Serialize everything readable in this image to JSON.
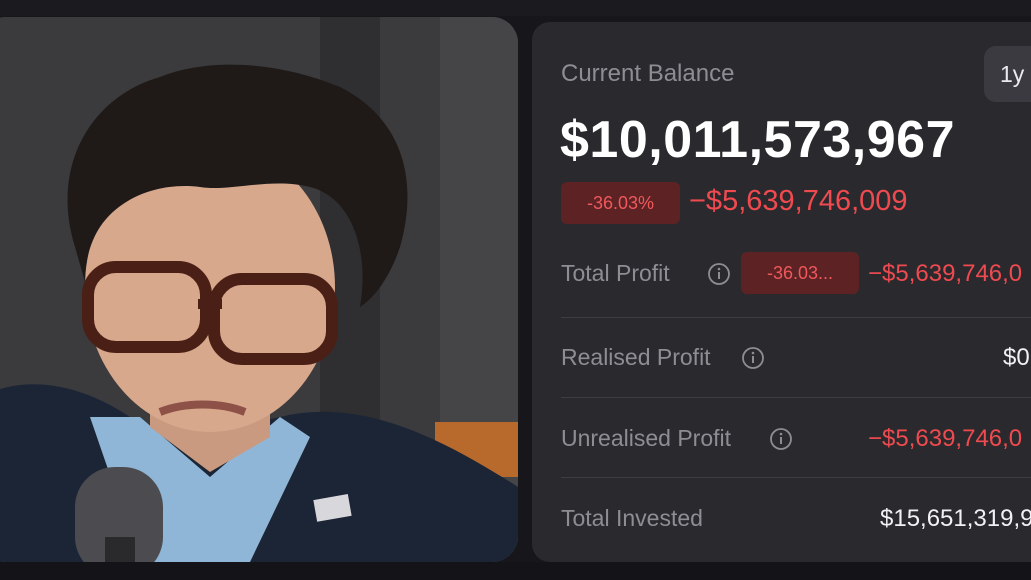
{
  "balance_card": {
    "current_balance_label": "Current Balance",
    "period_button": "1y",
    "balance": "$10,011,573,967",
    "change_percent": "-36.03%",
    "change_amount": "−$5,639,746,009"
  },
  "rows": {
    "total_profit": {
      "label": "Total Profit",
      "badge": "-36.03...",
      "value": "−$5,639,746,0"
    },
    "realised_profit": {
      "label": "Realised Profit",
      "value": "$0"
    },
    "unrealised_profit": {
      "label": "Unrealised Profit",
      "value": "−$5,639,746,0"
    },
    "total_invested": {
      "label": "Total Invested",
      "value": "$15,651,319,9"
    }
  },
  "colors": {
    "background": "#17171b",
    "panel": "#2a2a2e",
    "negative": "#ef4a4f",
    "badge_bg": "#5c2224",
    "muted_text": "#8d8d94"
  },
  "icons": [
    "info-icon"
  ]
}
